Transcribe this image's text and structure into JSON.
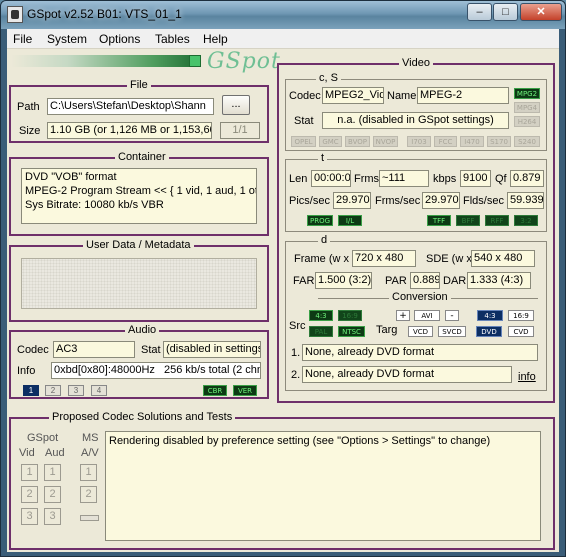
{
  "window": {
    "title": "GSpot v2.52 B01: VTS_01_1"
  },
  "menu": [
    "File",
    "System",
    "Options",
    "Tables",
    "Help"
  ],
  "logo": {
    "text": "GSpot"
  },
  "file": {
    "title": "File",
    "path_label": "Path",
    "path_value": "C:\\Users\\Stefan\\Desktop\\Shann",
    "browse_label": "...",
    "size_label": "Size",
    "size_value": "1.10 GB (or 1,126 MB or 1,153,60",
    "part_value": "1/1"
  },
  "container": {
    "title": "Container",
    "lines": [
      "DVD \"VOB\" format",
      "MPEG-2 Program Stream << { 1 vid, 1 aud, 1 othe",
      "Sys Bitrate: 10080 kb/s VBR"
    ]
  },
  "userdata": {
    "title": "User Data / Metadata"
  },
  "audio": {
    "title": "Audio",
    "codec_label": "Codec",
    "codec_value": "AC3",
    "stat_label": "Stat",
    "stat_value": "(disabled in settings)",
    "info_label": "Info",
    "info_value1": "0xbd[0x80]:48000Hz",
    "info_value2": "256 kb/s total (2 chnl",
    "streams": [
      "1",
      "2",
      "3",
      "4"
    ],
    "cbr": "CBR",
    "ver": "VER"
  },
  "video": {
    "title": "Video",
    "cs_title": "c, S",
    "codec_label": "Codec",
    "codec_value": "MPEG2_Vide",
    "name_label": "Name",
    "name_value": "MPEG-2",
    "mpeg_badges": [
      "MPG2",
      "MPG4",
      "H264"
    ],
    "stat_label": "Stat",
    "stat_value": "n.a. (disabled in GSpot settings)",
    "fourcc_badges": [
      "OPEL",
      "GMC",
      "BVOP",
      "NVOP",
      "I703",
      "FCC",
      "I470",
      "S170",
      "S240"
    ],
    "t_title": "t",
    "len_label": "Len",
    "len_value": "00:00:0",
    "frms_label": "Frms",
    "frms_value": "~111",
    "kbps_label": "kbps",
    "kbps_value": "9100",
    "qf_label": "Qf",
    "qf_value": "0.879",
    "pics_label": "Pics/sec",
    "pics_value": "29.970",
    "frmssec_label": "Frms/sec",
    "frmssec_value": "29.970",
    "flds_label": "Flds/sec",
    "flds_value": "59.939",
    "t_badges": [
      "PROG",
      "I/L",
      "TFF",
      "BFF",
      "RFF",
      "3:2"
    ],
    "d_title": "d",
    "frame_label": "Frame (w x",
    "frame_value": "720 x 480",
    "sde_label": "SDE (w x",
    "sde_value": "540 x 480",
    "far_label": "FAR",
    "far_value": "1.500 (3:2)",
    "par_label": "PAR",
    "par_value": "0.889",
    "dar_label": "DAR",
    "dar_value": "1.333 (4:3)",
    "conversion_title": "Conversion",
    "src_label": "Src",
    "src_badges": [
      "4:3",
      "16:9",
      "PAL",
      "NTSC"
    ],
    "targ_label": "Targ",
    "plus": "+",
    "avi": "AVI",
    "minus": "-",
    "targ_aspect": [
      "4:3",
      "16:9"
    ],
    "targ_formats": [
      "VCD",
      "SVCD",
      "DVD",
      "CVD"
    ],
    "conv1_num": "1.",
    "conv1_value": "None, already DVD format",
    "conv2_num": "2.",
    "conv2_value": "None, already DVD format",
    "info_link": "info"
  },
  "proposed": {
    "title": "Proposed Codec Solutions and Tests",
    "gspot_label": "GSpot",
    "ms_label": "MS",
    "vid_label": "Vid",
    "aud_label": "Aud",
    "av_label": "A/V",
    "nums": [
      "1",
      "2",
      "3"
    ],
    "message": "Rendering disabled by preference setting (see \"Options > Settings\" to change)"
  }
}
